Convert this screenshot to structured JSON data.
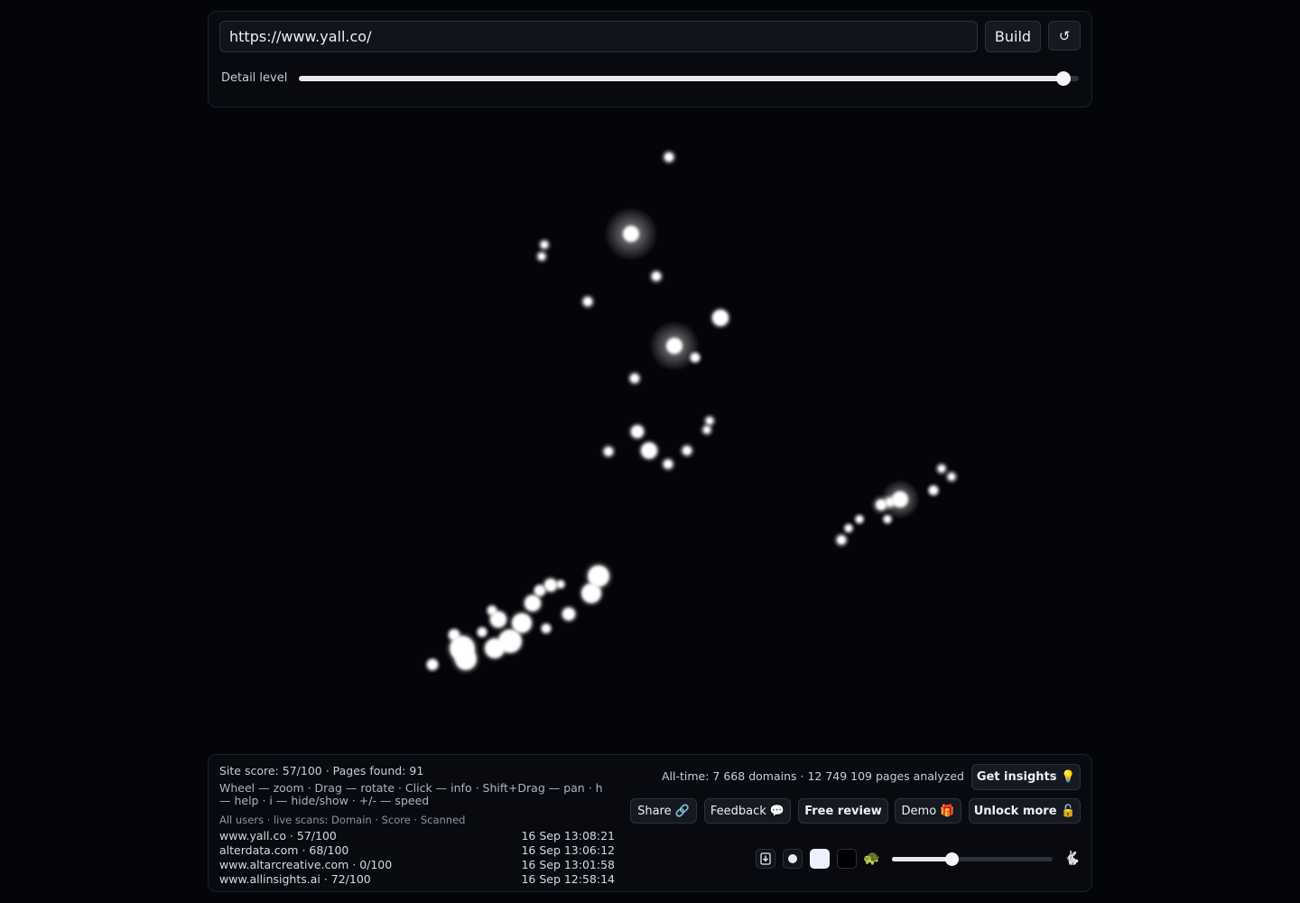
{
  "top": {
    "url_value": "https://www.yall.co/",
    "build_label": "Build",
    "reset_glyph": "↺",
    "detail_label": "Detail level",
    "detail_level": 0.98
  },
  "graph": {
    "node_color": "#ffffff",
    "background": "#04050a"
  },
  "bottom": {
    "site_summary": "Site score: 57/100 · Pages found: 91",
    "controls_help": "Wheel — zoom · Drag — rotate · Click — info · Shift+Drag — pan · h — help · i — hide/show · +/- — speed",
    "feed_title": "All users · live scans: Domain · Score · Scanned",
    "feed": [
      {
        "domain": "www.yall.co · 57/100",
        "time": "16 Sep 13:08:21"
      },
      {
        "domain": "alterdata.com · 68/100",
        "time": "16 Sep 13:06:12"
      },
      {
        "domain": "www.altarcreative.com · 0/100",
        "time": "16 Sep 13:01:58"
      },
      {
        "domain": "www.allinsights.ai · 72/100",
        "time": "16 Sep 12:58:14"
      }
    ],
    "alltime": "All-time: 7 668 domains · 12 749 109 pages analyzed",
    "insights_label": "Get insights 💡",
    "share_label": "Share 🔗",
    "feedback_label": "Feedback 💬",
    "review_label": "Free review",
    "demo_label": "Demo 🎁",
    "unlock_label": "Unlock more 🔓",
    "download_icon": "download-icon",
    "turtle_glyph": "🐢",
    "rabbit_glyph": "🐇",
    "speed_level": 0.37
  }
}
